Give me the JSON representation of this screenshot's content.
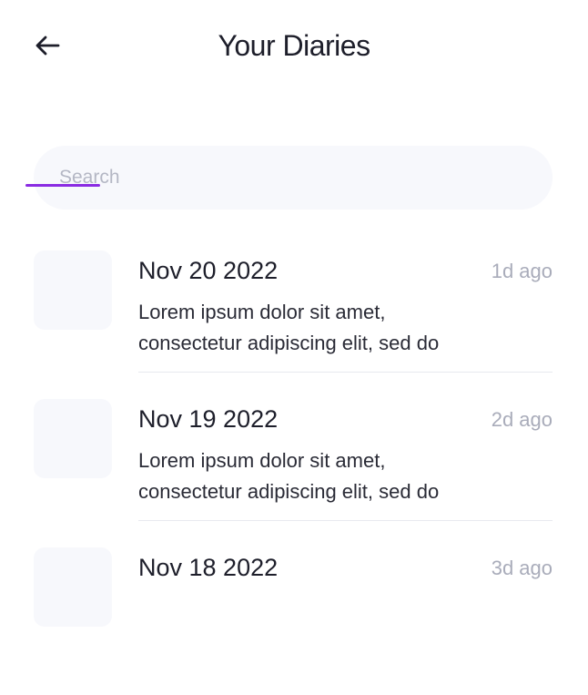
{
  "header": {
    "title": "Your Diaries",
    "back_icon": "arrow-left-icon"
  },
  "search": {
    "placeholder": "Search",
    "value": "",
    "accent_color": "#8A2BE2"
  },
  "entries": [
    {
      "date": "Nov 20 2022",
      "ago": "1d ago",
      "excerpt_line1": "Lorem ipsum dolor sit amet,",
      "excerpt_line2": "consectetur adipiscing elit, sed do"
    },
    {
      "date": "Nov 19 2022",
      "ago": "2d ago",
      "excerpt_line1": "Lorem ipsum dolor sit amet,",
      "excerpt_line2": "consectetur adipiscing elit, sed do"
    },
    {
      "date": "Nov 18 2022",
      "ago": "3d ago",
      "excerpt_line1": "",
      "excerpt_line2": ""
    }
  ]
}
